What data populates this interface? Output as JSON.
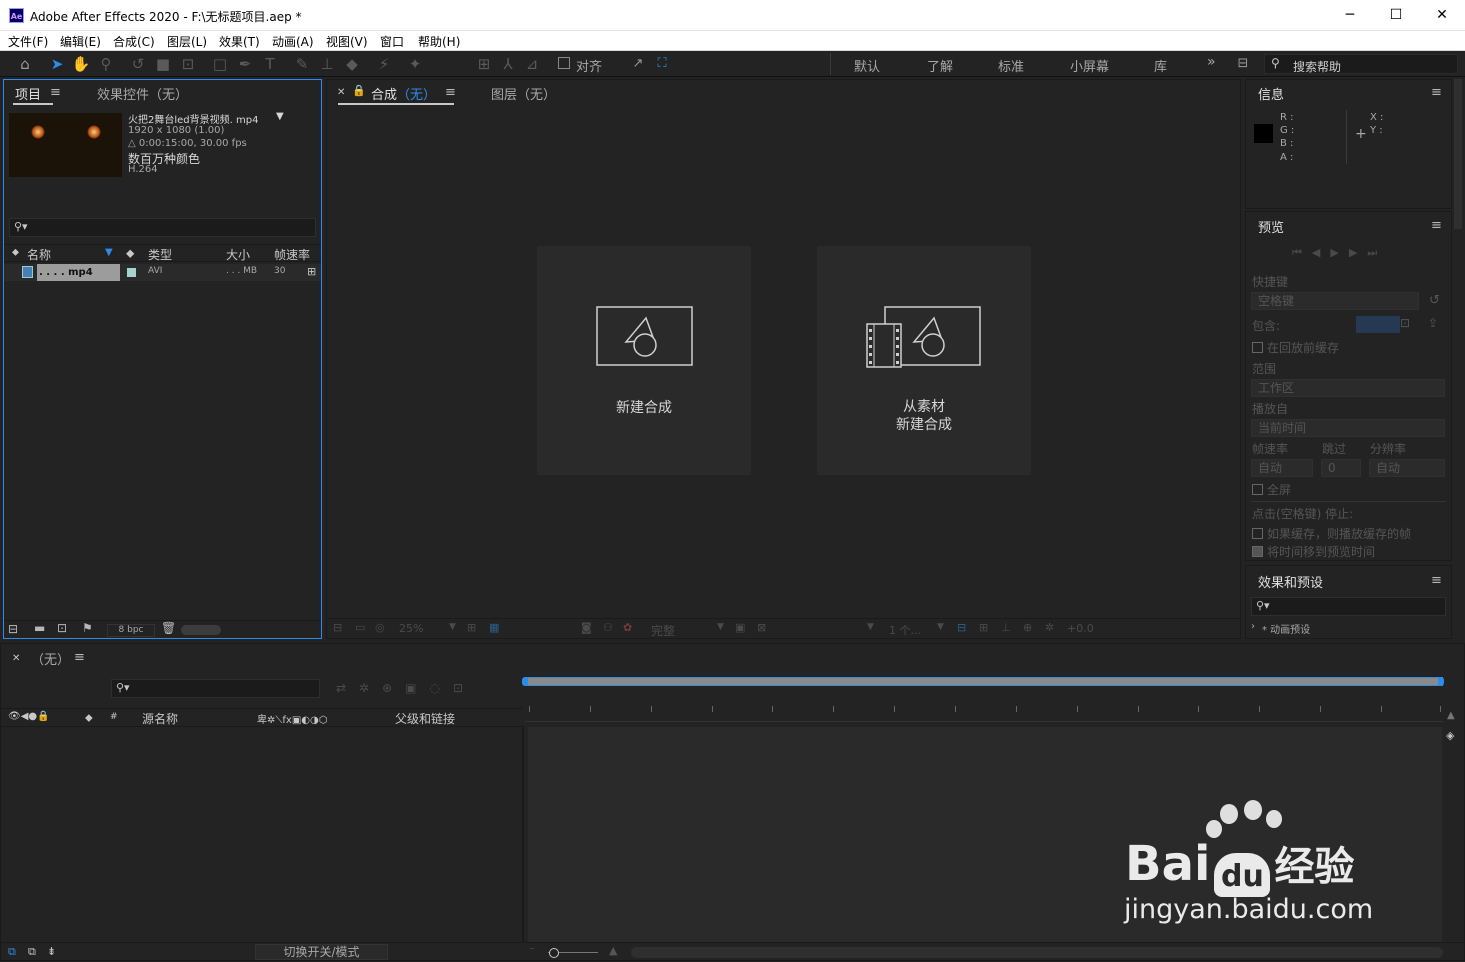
{
  "window": {
    "logo": "Ae",
    "title": "Adobe After Effects 2020 - F:\\无标题项目.aep *",
    "minimize": "─",
    "maximize": "☐",
    "close": "✕"
  },
  "menu": [
    "文件(F)",
    "编辑(E)",
    "合成(C)",
    "图层(L)",
    "效果(T)",
    "动画(A)",
    "视图(V)",
    "窗口",
    "帮助(H)"
  ],
  "toolbar": {
    "snap_label": "对齐",
    "workspaces": [
      "默认",
      "了解",
      "标准",
      "小屏幕",
      "库"
    ],
    "overflow": "»",
    "help_search": "搜索帮助"
  },
  "project": {
    "tab_project": "项目",
    "tab_effects": "效果控件（无）",
    "footage_name": "火把2舞台led背景视频. mp4",
    "footage_dims": "1920 x 1080 (1.00)",
    "footage_duration": "△ 0:00:15:00, 30.00 fps",
    "footage_colors": "数百万种颜色",
    "footage_codec": "H.264",
    "columns": {
      "name": "名称",
      "type": "类型",
      "size": "大小",
      "fps": "帧速率"
    },
    "rows": [
      {
        "name": ". . . . mp4",
        "type": "AVI",
        "size": ". . . MB",
        "fps": "30"
      }
    ],
    "bpc": "8 bpc"
  },
  "composition": {
    "tab_comp_prefix": "合成",
    "tab_comp_name": "（无）",
    "tab_layer": "图层（无）",
    "new_comp": "新建合成",
    "from_footage_line1": "从素材",
    "from_footage_line2": "新建合成",
    "zoom": "25%",
    "quality": "完整",
    "views": "1 个...",
    "exposure": "+0.0"
  },
  "info": {
    "title": "信息",
    "r": "R :",
    "g": "G :",
    "b": "B :",
    "a": "A :",
    "x": "X :",
    "y": "Y :"
  },
  "preview": {
    "title": "预览",
    "shortcut_label": "快捷键",
    "shortcut_value": "空格键",
    "include_label": "包含:",
    "cache_before": "在回放前缓存",
    "range_label": "范围",
    "range_value": "工作区",
    "play_from_label": "播放自",
    "play_from_value": "当前时间",
    "fps_label": "帧速率",
    "skip_label": "跳过",
    "resolution_label": "分辨率",
    "fps_value": "自动",
    "skip_value": "0",
    "resolution_value": "自动",
    "fullscreen": "全屏",
    "stop_label": "点击(空格键) 停止:",
    "stop_opt1": "如果缓存，则播放缓存的帧",
    "stop_opt2": "将时间移到预览时间"
  },
  "effects": {
    "title": "效果和预设",
    "item": "* 动画预设"
  },
  "timeline": {
    "tab_name": "（无）",
    "col_source": "源名称",
    "col_parent": "父级和链接",
    "col_num": "#",
    "toggle_modes": "切换开关/模式"
  },
  "watermark": {
    "brand": "Bai",
    "brand_suffix": "经验",
    "url": "jingyan.baidu.com"
  }
}
